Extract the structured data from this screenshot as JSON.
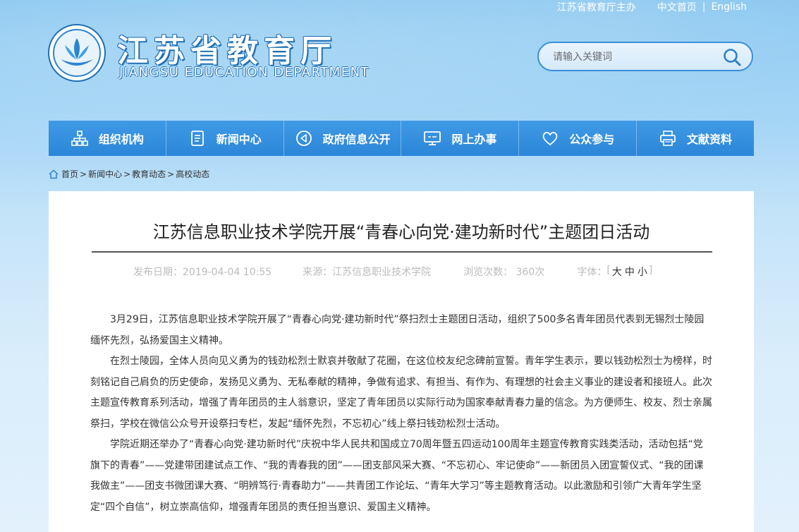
{
  "header": {
    "host_link": "江苏省教育厅主办",
    "links": [
      "中文首页",
      "English"
    ],
    "separator": "|",
    "logo_cn": "江苏省教育厅",
    "logo_en": "JIANGSU EDUCATION DEPARTMENT",
    "search": {
      "placeholder": "请输入关键词"
    }
  },
  "nav": {
    "items": [
      {
        "label": "组织机构",
        "icon": "org-chart-icon"
      },
      {
        "label": "新闻中心",
        "icon": "document-icon"
      },
      {
        "label": "政府信息公开",
        "icon": "disclosure-icon"
      },
      {
        "label": "网上办事",
        "icon": "monitor-icon"
      },
      {
        "label": "公众参与",
        "icon": "heart-icon"
      },
      {
        "label": "文献资料",
        "icon": "printer-icon"
      }
    ]
  },
  "breadcrumb": [
    "首页",
    "新闻中心",
    "教育动态",
    "高校动态"
  ],
  "article": {
    "title": "江苏信息职业技术学院开展“青春心向党·建功新时代”主题团日活动",
    "meta": {
      "date": "发布日期：2019-04-04 10:55",
      "source": "来源：江苏信息职业技术学院",
      "views": "浏览次数： 360次",
      "font_label": "字体：",
      "font_sizes": [
        "大",
        "中",
        "小"
      ]
    },
    "paragraphs": [
      "3月29日，江苏信息职业技术学院开展了“青春心向党·建功新时代”祭扫烈士主题团日活动，组织了500多名青年团员代表到无锡烈士陵园缅怀先烈，弘扬爱国主义精神。",
      "在烈士陵园，全体人员向见义勇为的钱劲松烈士默哀并敬献了花圈，在这位校友纪念碑前宣誓。青年学生表示，要以钱劲松烈士为榜样，时刻铭记自己肩负的历史使命，发扬见义勇为、无私奉献的精神，争做有追求、有担当、有作为、有理想的社会主义事业的建设者和接班人。此次主题宣传教育系列活动，增强了青年团员的主人翁意识，坚定了青年团员以实际行动为国家奉献青春力量的信念。为方便师生、校友、烈士亲属祭扫，学校在微信公众号开设祭扫专栏，发起“缅怀先烈，不忘初心”线上祭扫钱劲松烈士活动。",
      "学院近期还举办了“青春心向党·建功新时代”庆祝中华人民共和国成立70周年暨五四运动100周年主题宣传教育实践类活动，活动包括“党旗下的青春”——党建带团建试点工作、“我的青春我的团”——团支部风采大赛、“不忘初心、牢记使命”——新团员入团宣誓仪式、“我的团课我做主”——团支书微团课大赛、“明辨笃行·青春助力”——共青团工作论坛、“青年大学习”等主题教育活动。以此激励和引领广大青年学生坚定“四个自信”，树立崇高信仰，增强青年团员的责任担当意识、爱国主义精神。"
    ]
  }
}
